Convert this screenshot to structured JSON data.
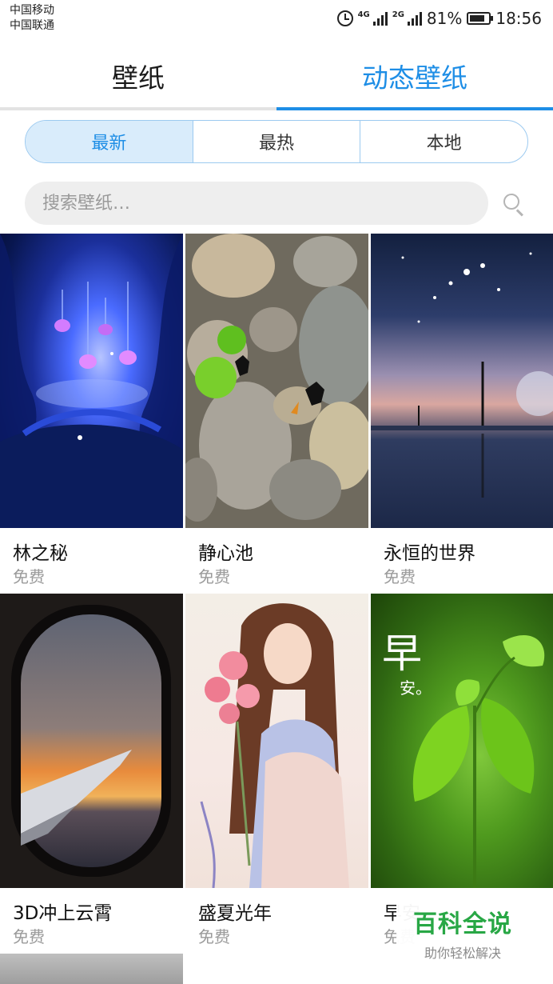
{
  "status_bar": {
    "carrier_1": "中国移动",
    "carrier_2": "中国联通",
    "net_1": "4G",
    "net_2": "2G",
    "battery": "81%",
    "battery_level": 0.81,
    "time": "18:56"
  },
  "tabs": [
    {
      "label": "壁纸",
      "active": false
    },
    {
      "label": "动态壁纸",
      "active": true
    }
  ],
  "filters": [
    {
      "label": "最新",
      "selected": true
    },
    {
      "label": "最热",
      "selected": false
    },
    {
      "label": "本地",
      "selected": false
    }
  ],
  "search": {
    "placeholder": "搜索壁纸…",
    "value": ""
  },
  "wallpapers": [
    {
      "name": "林之秘",
      "price": "免费",
      "art": "enchanted-forest"
    },
    {
      "name": "静心池",
      "price": "免费",
      "art": "pebbles-goldfish"
    },
    {
      "name": "永恒的世界",
      "price": "免费",
      "art": "starry-sky"
    },
    {
      "name": "3D冲上云霄",
      "price": "免费",
      "art": "airplane-window"
    },
    {
      "name": "盛夏光年",
      "price": "免费",
      "art": "girl-flowers"
    },
    {
      "name": "早安",
      "price": "免费",
      "art": "green-leaf",
      "overlay_big": "早",
      "overlay_small": "安。"
    },
    {
      "name": "",
      "price": "",
      "art": "grey-texture"
    }
  ],
  "watermark": {
    "title": "百科全说",
    "subtitle": "助你轻松解决"
  },
  "colors": {
    "accent": "#1e8ee6",
    "segment_bg": "#d9ecfb",
    "watermark_green": "#28a745"
  }
}
